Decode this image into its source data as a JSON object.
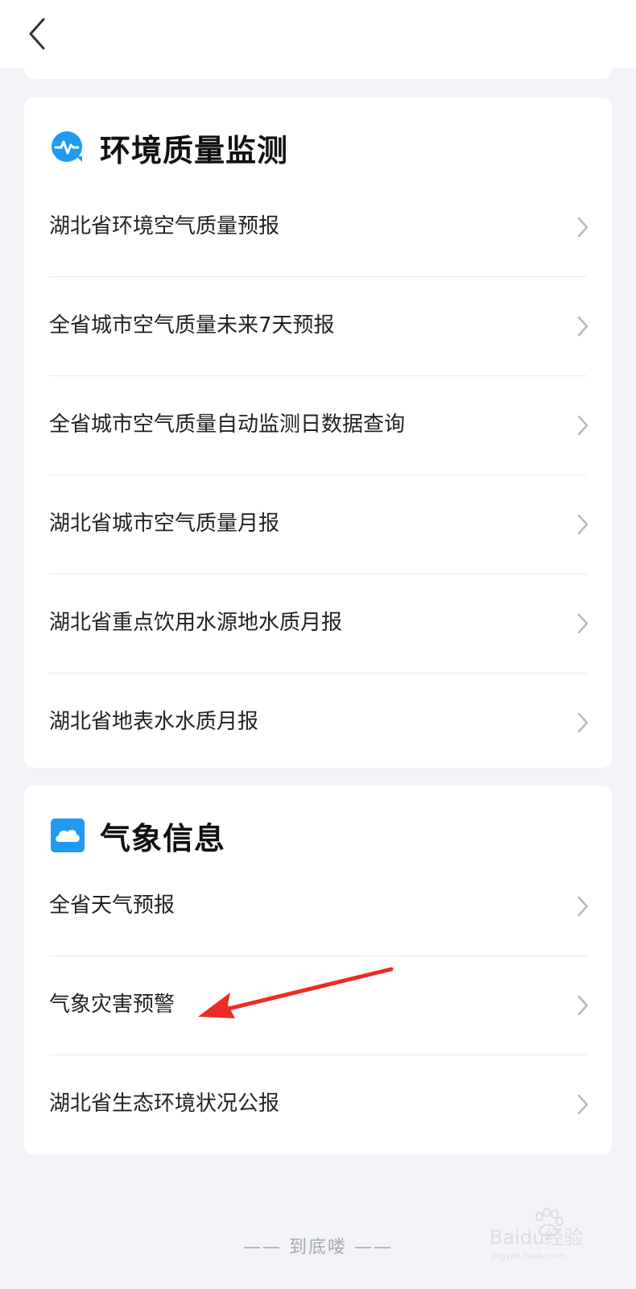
{
  "nav": {
    "back_icon": "chevron-left-icon"
  },
  "sections": [
    {
      "title": "环境质量监测",
      "icon": "env-monitor-icon",
      "items": [
        {
          "label": "湖北省环境空气质量预报"
        },
        {
          "label": "全省城市空气质量未来7天预报"
        },
        {
          "label": "全省城市空气质量自动监测日数据查询"
        },
        {
          "label": "湖北省城市空气质量月报"
        },
        {
          "label": "湖北省重点饮用水源地水质月报"
        },
        {
          "label": "湖北省地表水水质月报"
        }
      ]
    },
    {
      "title": "气象信息",
      "icon": "weather-cloud-icon",
      "items": [
        {
          "label": "全省天气预报"
        },
        {
          "label": "气象灾害预警"
        },
        {
          "label": "湖北省生态环境状况公报"
        }
      ]
    }
  ],
  "footer": {
    "text": "—— 到底喽 ——"
  },
  "watermark": {
    "text": "Baidu经验",
    "subtext": "jingyan.baidu.com"
  },
  "colors": {
    "background": "#f2f3f7",
    "card": "#ffffff",
    "accent_blue": "#1e9bf0",
    "annotation_red": "#ee2b24"
  }
}
